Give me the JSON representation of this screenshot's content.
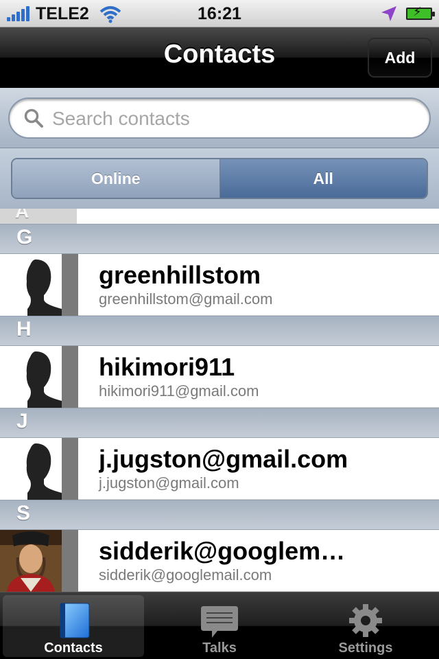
{
  "status_bar": {
    "carrier": "TELE2",
    "time": "16:21"
  },
  "nav_bar": {
    "title": "Contacts",
    "add_label": "Add"
  },
  "search": {
    "placeholder": "Search contacts",
    "value": ""
  },
  "segments": {
    "online_label": "Online",
    "all_label": "All",
    "selected": "All"
  },
  "list": {
    "partial_header": "A",
    "sections": [
      {
        "letter": "G",
        "contacts": [
          {
            "name": "greenhillstom",
            "email": "greenhillstom@gmail.com",
            "avatar": "silhouette"
          }
        ]
      },
      {
        "letter": "H",
        "contacts": [
          {
            "name": "hikimori911",
            "email": "hikimori911@gmail.com",
            "avatar": "silhouette"
          }
        ]
      },
      {
        "letter": "J",
        "contacts": [
          {
            "name": "j.jugston@gmail.com",
            "email": "j.jugston@gmail.com",
            "avatar": "silhouette"
          }
        ]
      },
      {
        "letter": "S",
        "contacts": [
          {
            "name": "sidderik@googlem…",
            "email": "sidderik@googlemail.com",
            "avatar": "portrait-photo"
          }
        ]
      }
    ]
  },
  "tab_bar": {
    "tabs": [
      {
        "label": "Contacts",
        "icon": "address-book-icon",
        "selected": true
      },
      {
        "label": "Talks",
        "icon": "chat-bubble-icon",
        "selected": false
      },
      {
        "label": "Settings",
        "icon": "gear-icon",
        "selected": false
      }
    ]
  },
  "colors": {
    "segment_selected": "#4a6b98",
    "battery": "#3fbf27",
    "signal": "#2f6fc8",
    "location_arrow": "#8e44c8"
  }
}
